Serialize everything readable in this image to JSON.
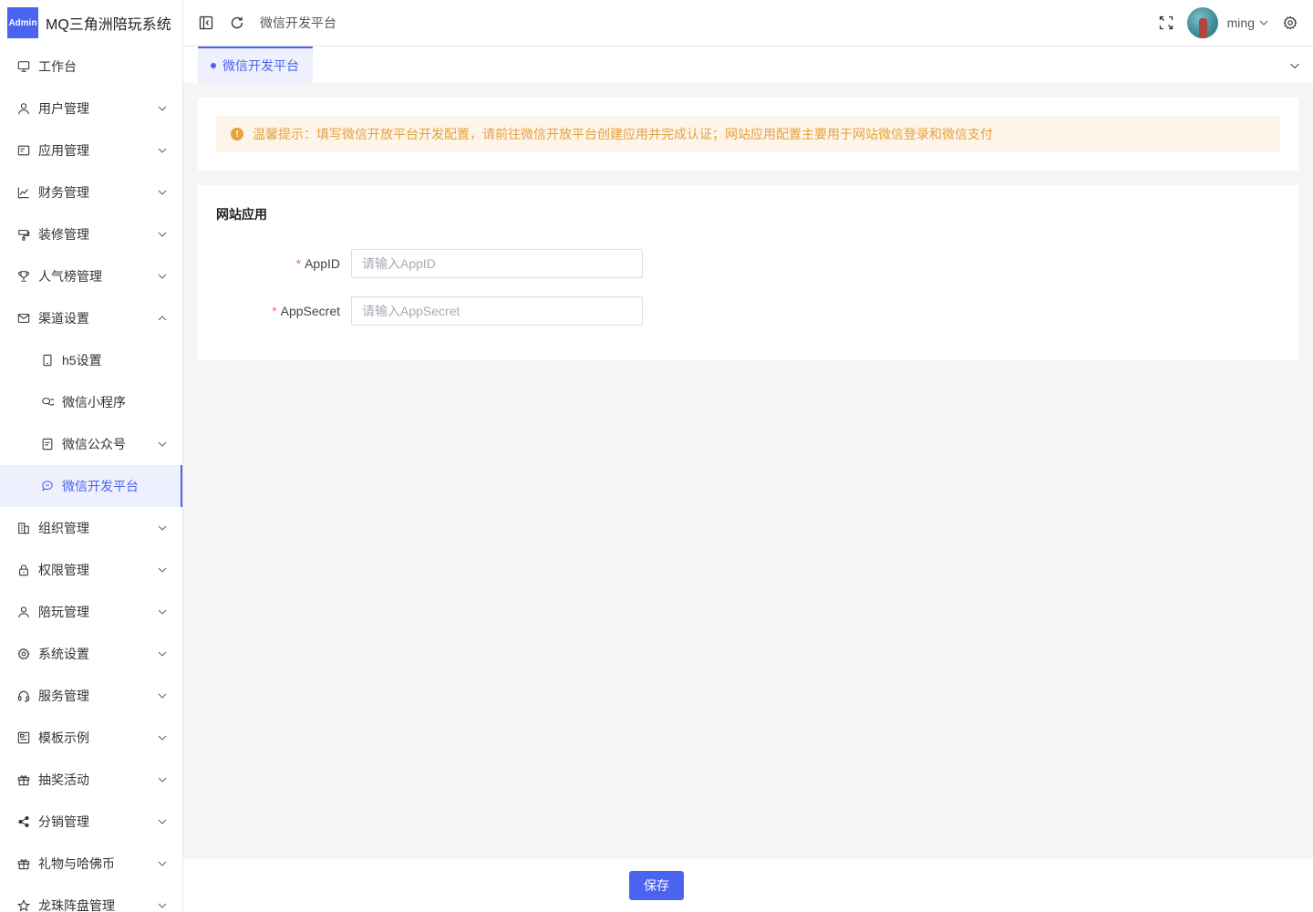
{
  "app": {
    "logo_badge": "Admin",
    "title": "MQ三角洲陪玩系统"
  },
  "sidebar": {
    "items": [
      {
        "label": "工作台",
        "icon": "monitor-icon",
        "has_arrow": false
      },
      {
        "label": "用户管理",
        "icon": "user-icon",
        "has_arrow": true
      },
      {
        "label": "应用管理",
        "icon": "app-card-icon",
        "has_arrow": true
      },
      {
        "label": "财务管理",
        "icon": "chart-icon",
        "has_arrow": true
      },
      {
        "label": "装修管理",
        "icon": "brush-icon",
        "has_arrow": true
      },
      {
        "label": "人气榜管理",
        "icon": "trophy-icon",
        "has_arrow": true
      },
      {
        "label": "渠道设置",
        "icon": "mail-icon",
        "has_arrow": true,
        "expanded": true
      },
      {
        "label": "h5设置",
        "icon": "phone-icon",
        "sub": true,
        "has_arrow": false
      },
      {
        "label": "微信小程序",
        "icon": "chat-icon",
        "sub": true,
        "has_arrow": false
      },
      {
        "label": "微信公众号",
        "icon": "document-icon",
        "sub": true,
        "has_arrow": true
      },
      {
        "label": "微信开发平台",
        "icon": "chat-bubble-icon",
        "sub": true,
        "has_arrow": false,
        "active": true
      },
      {
        "label": "组织管理",
        "icon": "building-icon",
        "has_arrow": true
      },
      {
        "label": "权限管理",
        "icon": "lock-icon",
        "has_arrow": true
      },
      {
        "label": "陪玩管理",
        "icon": "user-icon",
        "has_arrow": true
      },
      {
        "label": "系统设置",
        "icon": "gear-icon",
        "has_arrow": true
      },
      {
        "label": "服务管理",
        "icon": "headset-icon",
        "has_arrow": true
      },
      {
        "label": "模板示例",
        "icon": "template-icon",
        "has_arrow": true
      },
      {
        "label": "抽奖活动",
        "icon": "gift-icon",
        "has_arrow": true
      },
      {
        "label": "分销管理",
        "icon": "share-icon",
        "has_arrow": true
      },
      {
        "label": "礼物与哈佛币",
        "icon": "gift-icon",
        "has_arrow": true
      },
      {
        "label": "龙珠阵盘管理",
        "icon": "star-icon",
        "has_arrow": true
      }
    ]
  },
  "topbar": {
    "breadcrumb": "微信开发平台",
    "username": "ming"
  },
  "tabs": [
    {
      "label": "微信开发平台",
      "active": true
    }
  ],
  "notice": {
    "text": "温馨提示：填写微信开放平台开发配置，请前往微信开放平台创建应用并完成认证；网站应用配置主要用于网站微信登录和微信支付"
  },
  "form": {
    "section_title": "网站应用",
    "fields": [
      {
        "label": "AppID",
        "required": "*",
        "placeholder": "请输入AppID",
        "value": ""
      },
      {
        "label": "AppSecret",
        "required": "*",
        "placeholder": "请输入AppSecret",
        "value": ""
      }
    ]
  },
  "footer": {
    "save_label": "保存"
  },
  "colors": {
    "accent": "#4a63f1",
    "warning": "#e6a23c",
    "warning_bg": "#fdf4ea",
    "required": "#f56c6c"
  }
}
